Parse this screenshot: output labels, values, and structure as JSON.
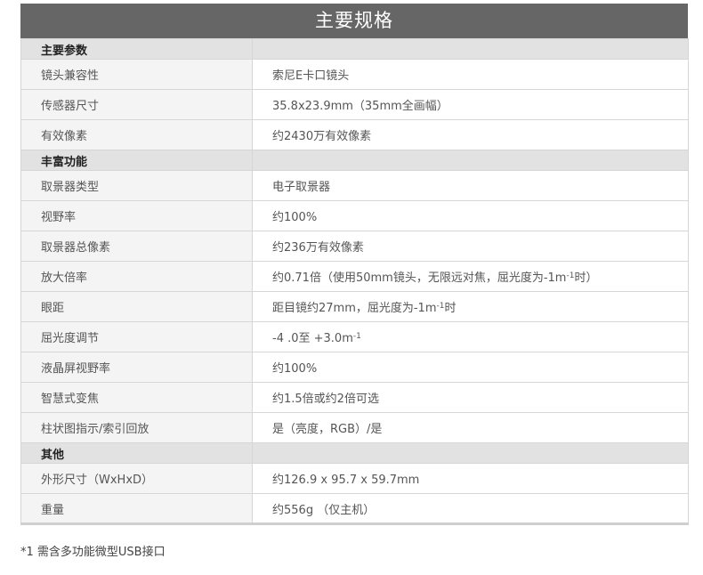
{
  "title": "主要规格",
  "sections": [
    {
      "name": "主要参数",
      "rows": [
        {
          "label": "镜头兼容性",
          "value": "索尼E卡口镜头"
        },
        {
          "label": "传感器尺寸",
          "value": "35.8x23.9mm（35mm全画幅）"
        },
        {
          "label": "有效像素",
          "value": "约2430万有效像素"
        }
      ]
    },
    {
      "name": "丰富功能",
      "rows": [
        {
          "label": "取景器类型",
          "value": "电子取景器"
        },
        {
          "label": "视野率",
          "value": "约100%"
        },
        {
          "label": "取景器总像素",
          "value": "约236万有效像素"
        },
        {
          "label": "放大倍率",
          "value": "约0.71倍（使用50mm镜头，无限远对焦，屈光度为-1m",
          "sup": "-1",
          "suffix": "时）"
        },
        {
          "label": "眼距",
          "value": "距目镜约27mm，屈光度为-1m",
          "sup": "-1",
          "suffix": "时"
        },
        {
          "label": "屈光度调节",
          "value": "-4 .0至 +3.0m",
          "sup": "-1",
          "suffix": ""
        },
        {
          "label": "液晶屏视野率",
          "value": "约100%"
        },
        {
          "label": "智慧式变焦",
          "value": "约1.5倍或约2倍可选"
        },
        {
          "label": "柱状图指示/索引回放",
          "value": "是（亮度，RGB）/是"
        }
      ]
    },
    {
      "name": "其他",
      "rows": [
        {
          "label": "外形尺寸（WxHxD）",
          "value": "约126.9 x 95.7 x 59.7mm"
        },
        {
          "label": "重量",
          "value": "约556g （仅主机）"
        }
      ]
    }
  ],
  "footnote": "*1 需含多功能微型USB接口"
}
